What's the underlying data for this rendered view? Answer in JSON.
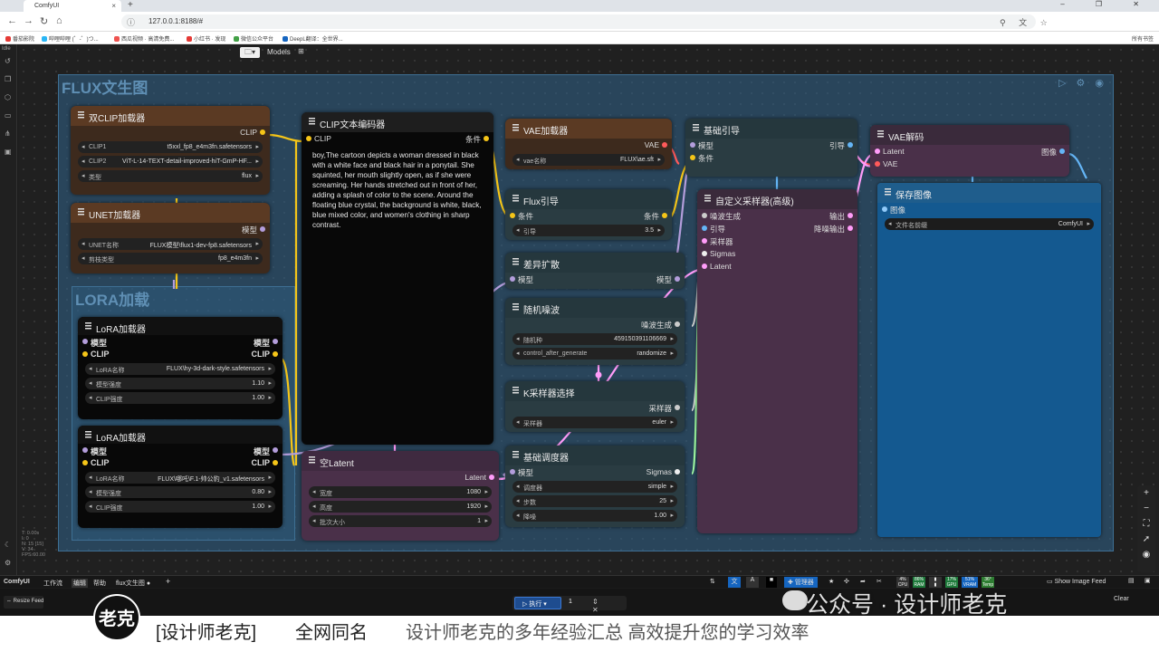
{
  "browser": {
    "tab_title": "ComfyUI",
    "new_tab": "+",
    "url": "127.0.0.1:8188/#",
    "window_controls": "– ❐ ✕",
    "bookmarks": [
      "番茄影院",
      "哔哩哔哩 (゜-゜)つ...",
      "西瓜视频 · 高清免费...",
      "小红书 · 发现",
      "微信公众平台",
      "DeepL翻译：全世界..."
    ],
    "bookmarks_right": "所有书签"
  },
  "sidebar": {
    "label": "Idle"
  },
  "toolbar": {
    "folder": "🗀▾",
    "models": "Models"
  },
  "groups": {
    "flux": "FLUX文生图",
    "lora": "LORA加载"
  },
  "nodes": {
    "dual_clip": {
      "title": "双CLIP加载器",
      "out_clip": "CLIP",
      "w1_label": "CLIP1",
      "w1_value": "t5xxl_fp8_e4m3fn.safetensors",
      "w2_label": "CLIP2",
      "w2_value": "ViT-L-14-TEXT-detail-improved-hiT-GmP-HF...",
      "w3_label": "类型",
      "w3_value": "flux"
    },
    "unet": {
      "title": "UNET加载器",
      "out_model": "模型",
      "w1_label": "UNET名称",
      "w1_value": "FLUX模型\\flux1-dev-fp8.safetensors",
      "w2_label": "剪枝类型",
      "w2_value": "fp8_e4m3fn"
    },
    "lora1": {
      "title": "LoRA加载器",
      "in_model": "模型",
      "in_clip": "CLIP",
      "out_model": "模型",
      "out_clip": "CLIP",
      "w1_label": "LoRA名称",
      "w1_value": "FLUX\\hy-3d-dark-style.safetensors",
      "w2_label": "模型强度",
      "w2_value": "1.10",
      "w3_label": "CLIP强度",
      "w3_value": "1.00"
    },
    "lora2": {
      "title": "LoRA加载器",
      "in_model": "模型",
      "in_clip": "CLIP",
      "out_model": "模型",
      "out_clip": "CLIP",
      "w1_label": "LoRA名称",
      "w1_value": "FLUX\\哪吒\\F.1-帅公豹_v1.safetensors",
      "w2_label": "模型强度",
      "w2_value": "0.80",
      "w3_label": "CLIP强度",
      "w3_value": "1.00"
    },
    "clip_text": {
      "title": "CLIP文本编码器",
      "in_clip": "CLIP",
      "out_cond": "条件",
      "text": "boy,The cartoon depicts a woman dressed in black with a white face and black hair in a ponytail. She squinted, her mouth slightly open, as if she were screaming. Her hands stretched out in front of her, adding a splash of color to the scene. Around the floating blue crystal, the background is white, black, blue mixed color, and women's clothing in sharp contrast."
    },
    "empty_latent": {
      "title": "空Latent",
      "out_latent": "Latent",
      "w1_label": "宽度",
      "w1_value": "1080",
      "w2_label": "高度",
      "w2_value": "1920",
      "w3_label": "批次大小",
      "w3_value": "1"
    },
    "vae_loader": {
      "title": "VAE加载器",
      "out_vae": "VAE",
      "w1_label": "vae名称",
      "w1_value": "FLUX\\ae.sft"
    },
    "flux_guidance": {
      "title": "Flux引导",
      "in_cond": "条件",
      "out_cond": "条件",
      "w1_label": "引导",
      "w1_value": "3.5"
    },
    "diff_diffusion": {
      "title": "差异扩散",
      "in_model": "模型",
      "out_model": "模型"
    },
    "random_noise": {
      "title": "随机噪波",
      "out_noise": "噪波生成",
      "w1_label": "随机种",
      "w1_value": "459150391106669",
      "w2_label": "control_after_generate",
      "w2_value": "randomize"
    },
    "k_sampler_select": {
      "title": "K采样器选择",
      "out_sampler": "采样器",
      "w1_label": "采样器",
      "w1_value": "euler"
    },
    "basic_scheduler": {
      "title": "基础调度器",
      "in_model": "模型",
      "out_sigmas": "Sigmas",
      "w1_label": "调度器",
      "w1_value": "simple",
      "w2_label": "步数",
      "w2_value": "25",
      "w3_label": "降噪",
      "w3_value": "1.00"
    },
    "basic_guider": {
      "title": "基础引导",
      "in_model": "模型",
      "in_cond": "条件",
      "out_guider": "引导"
    },
    "custom_sampler": {
      "title": "自定义采样器(高级)",
      "in_noise": "噪波生成",
      "in_guider": "引导",
      "in_sampler": "采样器",
      "in_sigmas": "Sigmas",
      "in_latent": "Latent",
      "out_output": "输出",
      "out_denoised": "降噪输出"
    },
    "vae_decode": {
      "title": "VAE解码",
      "in_latent": "Latent",
      "in_vae": "VAE",
      "out_image": "图像"
    },
    "save_image": {
      "title": "保存图像",
      "in_image": "图像",
      "w1_label": "文件名前缀",
      "w1_value": "ComfyUI"
    }
  },
  "bottom_bar": {
    "app": "ComfyUI",
    "menu_workflow": "工作流",
    "menu_edit": "编辑",
    "menu_help": "帮助",
    "workflow_tab": "flux文生图",
    "add_tab": "+",
    "manager": "管理器",
    "cpu": "CPU",
    "cpu_val": "4%",
    "ram": "RAM",
    "ram_val": "86%",
    "gpu": "GPU",
    "gpu_val": "17%",
    "vram": "VRAM",
    "vram_val": "51%",
    "temp": "Temp",
    "temp_val": "36°",
    "image_feed": "Show Image Feed"
  },
  "queue": {
    "resize_feed": "Resize Feed",
    "run": "执行",
    "count": "1",
    "clear": "Clear"
  },
  "watermark": "公众号 · 设计师老克",
  "caption": {
    "part1": "[设计师老克]",
    "part2": "全网同名",
    "part3": "设计师老克的多年经验汇总  高效提升您的学习效率"
  },
  "logo_text": "老克",
  "colors": {
    "clip": "#f5c518",
    "vae": "#ff5a5a",
    "model": "#b39ddb",
    "latent": "#ff9cf9",
    "image": "#64b5f6"
  }
}
